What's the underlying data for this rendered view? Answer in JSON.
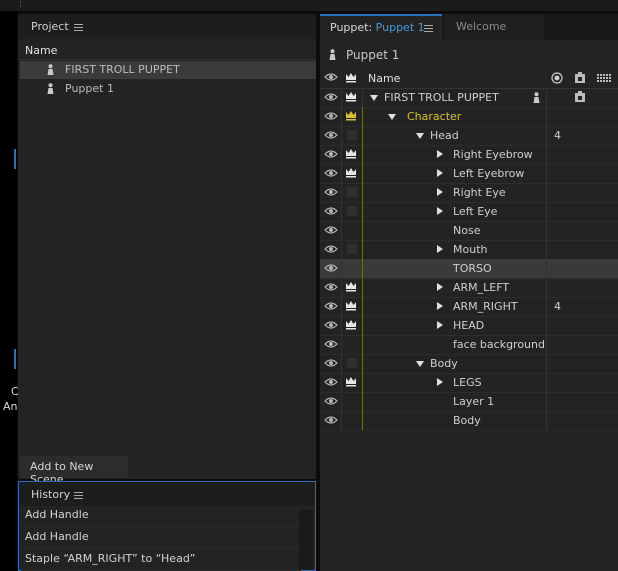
{
  "left_edge": {
    "frag1": "C",
    "frag2": "An"
  },
  "project": {
    "title": "Project",
    "column_name": "Name",
    "items": [
      {
        "label": "FIRST TROLL PUPPET",
        "selected": true
      },
      {
        "label": "Puppet 1",
        "selected": false
      }
    ],
    "add_button": "Add to New Scene"
  },
  "history": {
    "title": "History",
    "items": [
      "Add Handle",
      "Add Handle",
      "Staple “ARM_RIGHT” to “Head”"
    ]
  },
  "puppet_panel": {
    "tab_prefix": "Puppet: ",
    "tab_name": "Puppet 1",
    "tab_welcome": "Welcome",
    "puppet_name": "Puppet 1",
    "column_name": "Name",
    "rows": [
      {
        "label": "FIRST TROLL PUPPET",
        "level": 0,
        "expander": "down",
        "crown": "white",
        "value": "",
        "puppet_icon": true,
        "right_icon": true
      },
      {
        "label": "Character",
        "level": 1,
        "expander": "down",
        "crown": "yellow",
        "value": "",
        "yellow": true
      },
      {
        "label": "Head",
        "level": 2,
        "expander": "down",
        "crown": "none",
        "value": "4"
      },
      {
        "label": "Right Eyebrow",
        "level": 3,
        "expander": "right",
        "crown": "white",
        "value": ""
      },
      {
        "label": "Left Eyebrow",
        "level": 3,
        "expander": "right",
        "crown": "white",
        "value": ""
      },
      {
        "label": "Right Eye",
        "level": 3,
        "expander": "right",
        "crown": "none",
        "value": ""
      },
      {
        "label": "Left Eye",
        "level": 3,
        "expander": "right",
        "crown": "none",
        "value": ""
      },
      {
        "label": "Nose",
        "level": 3,
        "expander": "",
        "crown": "blank",
        "value": ""
      },
      {
        "label": "Mouth",
        "level": 3,
        "expander": "right",
        "crown": "none",
        "value": ""
      },
      {
        "label": "TORSO",
        "level": 3,
        "expander": "",
        "crown": "blank",
        "value": "",
        "selected": true
      },
      {
        "label": "ARM_LEFT",
        "level": 3,
        "expander": "right",
        "crown": "white",
        "value": ""
      },
      {
        "label": "ARM_RIGHT",
        "level": 3,
        "expander": "right",
        "crown": "white",
        "value": "4"
      },
      {
        "label": "HEAD",
        "level": 3,
        "expander": "right",
        "crown": "white",
        "value": ""
      },
      {
        "label": "face background",
        "level": 3,
        "expander": "",
        "crown": "blank",
        "value": ""
      },
      {
        "label": "Body",
        "level": 2,
        "expander": "down",
        "crown": "none",
        "value": ""
      },
      {
        "label": "LEGS",
        "level": 3,
        "expander": "right",
        "crown": "white",
        "value": ""
      },
      {
        "label": "Layer 1",
        "level": 3,
        "expander": "",
        "crown": "blank",
        "value": ""
      },
      {
        "label": "Body",
        "level": 3,
        "expander": "",
        "crown": "blank",
        "value": ""
      }
    ]
  },
  "colors": {
    "accent": "#2a6fb8",
    "tab_highlight": "#3d9de0",
    "yellow": "#d7c22a"
  }
}
